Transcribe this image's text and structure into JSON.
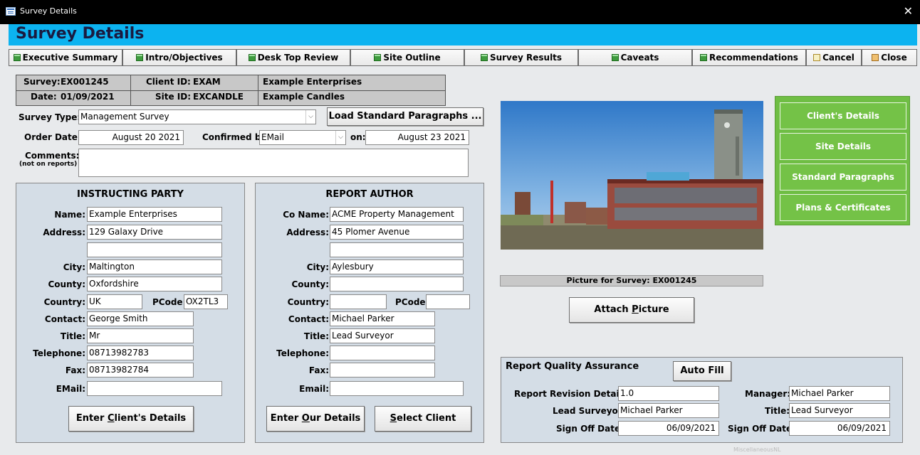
{
  "window": {
    "title": "Survey Details",
    "close": "✕"
  },
  "header": {
    "title": "Survey Details"
  },
  "nav": [
    {
      "label": "Executive Summary"
    },
    {
      "label": "Intro/Objectives"
    },
    {
      "label": "Desk Top Review"
    },
    {
      "label": "Site Outline"
    },
    {
      "label": "Survey Results"
    },
    {
      "label": "Caveats"
    },
    {
      "label": "Recommendations"
    },
    {
      "label": "Cancel"
    },
    {
      "label": "Close"
    }
  ],
  "info": {
    "survey_label": "Survey:",
    "survey": "EX001245",
    "date_label": "Date:",
    "date": "01/09/2021",
    "client_id_label": "Client ID:",
    "client_id": "EXAM",
    "site_id_label": "Site ID:",
    "site_id": "EXCANDLE",
    "client_name": "Example Enterprises",
    "site_name": "Example Candles"
  },
  "form": {
    "survey_type_label": "Survey Type:",
    "survey_type": "Management Survey",
    "load_button": "Load Standard Paragraphs ...",
    "order_date_label": "Order Date:",
    "order_date": "August 20 2021",
    "confirmed_by_label": "Confirmed by:",
    "confirmed_by": "EMail",
    "on_label": "on:",
    "on_date": "August 23 2021",
    "comments_label": "Comments:",
    "comments_note": "(not on reports)",
    "comments": ""
  },
  "instructing": {
    "title": "INSTRUCTING PARTY",
    "name_label": "Name:",
    "name": "Example Enterprises",
    "address_label": "Address:",
    "address1": "129 Galaxy Drive",
    "address2": "",
    "city_label": "City:",
    "city": "Maltington",
    "county_label": "County:",
    "county": "Oxfordshire",
    "country_label": "Country:",
    "country": "UK",
    "pcode_label": "PCode:",
    "pcode": "OX2TL3",
    "contact_label": "Contact:",
    "contact": "George Smith",
    "title_label": "Title:",
    "title_value": "Mr",
    "telephone_label": "Telephone:",
    "telephone": "08713982783",
    "fax_label": "Fax:",
    "fax": "08713982784",
    "email_label": "EMail:",
    "email": "",
    "button_pre": "Enter ",
    "button_key": "C",
    "button_post": "lient's Details"
  },
  "author": {
    "title": "REPORT AUTHOR",
    "co_name_label": "Co Name:",
    "co_name": "ACME Property Management",
    "address_label": "Address:",
    "address1": "45 Plomer Avenue",
    "address2": "",
    "city_label": "City:",
    "city": "Aylesbury",
    "county_label": "County:",
    "county": "",
    "country_label": "Country:",
    "country": "",
    "pcode_label": "PCode:",
    "pcode": "",
    "contact_label": "Contact:",
    "contact": "Michael Parker",
    "title_label": "Title:",
    "title_value": "Lead Surveyor",
    "telephone_label": "Telephone:",
    "telephone": "",
    "fax_label": "Fax:",
    "fax": "",
    "email_label": "Email:",
    "email": "",
    "our_button_pre": "Enter ",
    "our_button_key": "O",
    "our_button_post": "ur Details",
    "select_button_pre": "",
    "select_button_key": "S",
    "select_button_post": "elect Client"
  },
  "picture": {
    "caption": "Picture for Survey: EX001245",
    "attach_pre": "Attach ",
    "attach_key": "P",
    "attach_post": "icture"
  },
  "side_buttons": [
    {
      "label": "Client's Details"
    },
    {
      "label": "Site Details"
    },
    {
      "label": "Standard Paragraphs"
    },
    {
      "label": "Plans & Certificates"
    }
  ],
  "qa": {
    "title": "Report Quality Assurance",
    "auto_fill": "Auto Fill",
    "revision_label": "Report Revision Details:",
    "revision": "1.0",
    "lead_label": "Lead Surveyor:",
    "lead": "Michael Parker",
    "signoff_label": "Sign Off Date:",
    "signoff": "06/09/2021",
    "manager_label": "Manager:",
    "manager": "Michael Parker",
    "title_label": "Title:",
    "title_value": "Lead Surveyor",
    "signoff2_label": "Sign Off Date:",
    "signoff2": "06/09/2021"
  },
  "watermark": "MiscellaneousNL",
  "colors": {
    "header": "#0cb3f0",
    "green_panel": "#6fbe44",
    "panel_bg": "#d4dde6"
  }
}
